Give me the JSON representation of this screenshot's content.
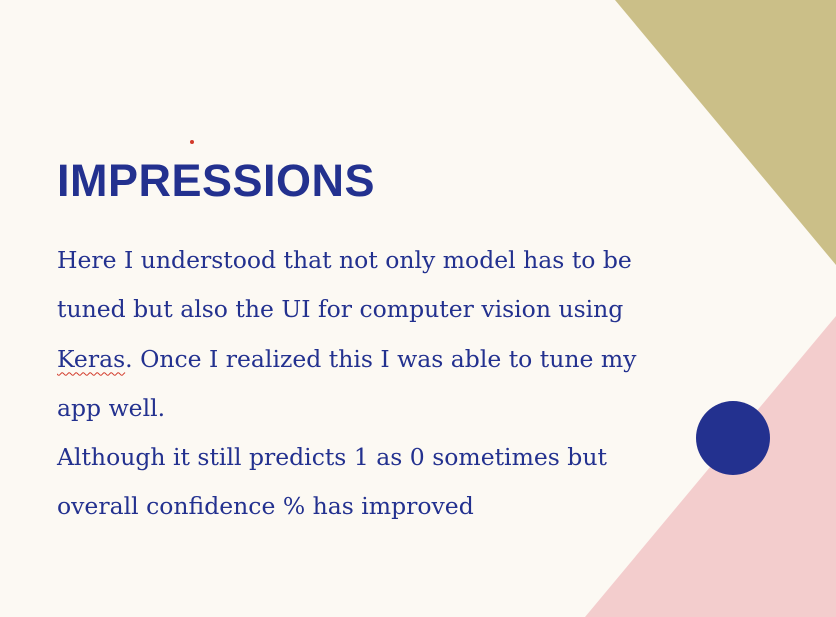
{
  "slide": {
    "title": "IMPRESSIONS",
    "paragraph1": {
      "before": "Here I understood that not only model has to be tuned but also the UI for computer vision using ",
      "flagged_word": "Keras",
      "after": ". Once I realized this I was able to tune my app well."
    },
    "paragraph2": "Although it still predicts 1 as 0 sometimes but overall confidence % has improved"
  },
  "colors": {
    "background": "#fcf9f3",
    "text": "#23318f",
    "gold_triangle": "#cbbf88",
    "pink_triangle": "#f3cdcd",
    "circle": "#23318f",
    "spellcheck_underline": "#d23a2a"
  }
}
